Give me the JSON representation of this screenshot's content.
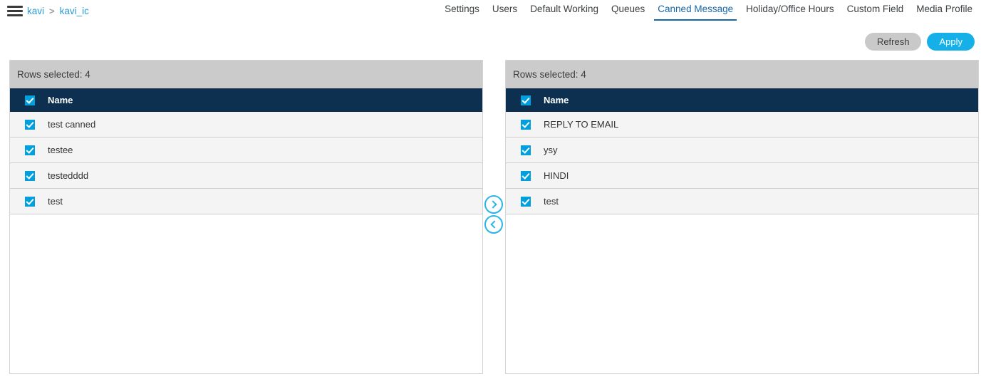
{
  "topbar": {
    "menu_icon": "hamburger-icon",
    "breadcrumb": {
      "root": "kavi",
      "separator": ">",
      "current": "kavi_ic"
    },
    "tabs": [
      {
        "label": "Settings",
        "active": false
      },
      {
        "label": "Users",
        "active": false
      },
      {
        "label": "Default Working",
        "active": false
      },
      {
        "label": "Queues",
        "active": false
      },
      {
        "label": "Canned Message",
        "active": true
      },
      {
        "label": "Holiday/Office Hours",
        "active": false
      },
      {
        "label": "Custom Field",
        "active": false
      },
      {
        "label": "Media Profile",
        "active": false
      }
    ]
  },
  "actions": {
    "refresh_label": "Refresh",
    "apply_label": "Apply"
  },
  "left_panel": {
    "status": "Rows selected: 4",
    "column_header": "Name",
    "header_checked": true,
    "rows": [
      {
        "name": "test canned",
        "checked": true
      },
      {
        "name": "testee",
        "checked": true
      },
      {
        "name": "testedddd",
        "checked": true
      },
      {
        "name": "test",
        "checked": true
      }
    ]
  },
  "right_panel": {
    "status": "Rows selected: 4",
    "column_header": "Name",
    "header_checked": true,
    "rows": [
      {
        "name": "REPLY TO EMAIL",
        "checked": true
      },
      {
        "name": "ysy",
        "checked": true
      },
      {
        "name": "HINDI",
        "checked": true
      },
      {
        "name": "test",
        "checked": true
      }
    ]
  },
  "transfer": {
    "move_right_icon": "chevron-right-icon",
    "move_left_icon": "chevron-left-icon"
  },
  "colors": {
    "accent_cyan": "#00a0df",
    "apply_blue": "#16b0e8",
    "header_navy": "#0e3050",
    "tab_active_blue": "#1768a8",
    "panel_status_grey": "#cbcbcb",
    "row_grey": "#f4f4f4",
    "refresh_grey": "#c9c9c9"
  }
}
